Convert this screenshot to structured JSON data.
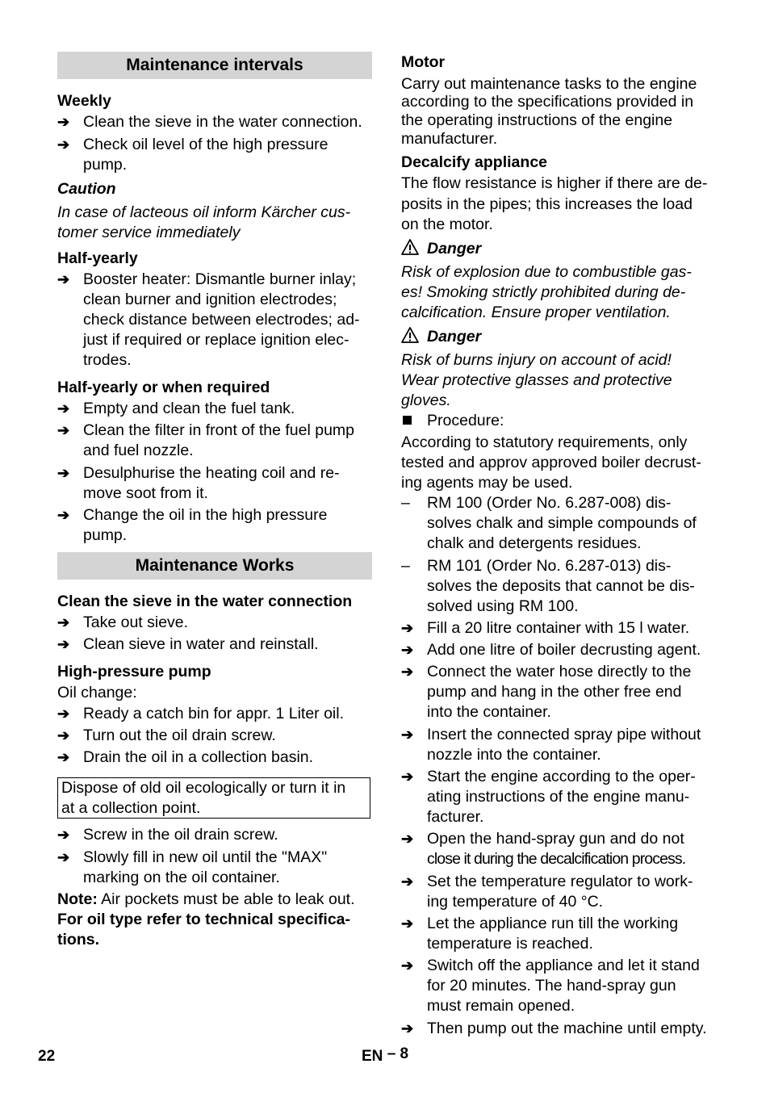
{
  "left": {
    "maintenance_intervals": {
      "title": "Maintenance intervals",
      "weekly": {
        "heading": "Weekly",
        "items": [
          [
            "Clean the sieve in the water connection."
          ],
          [
            "Check oil level of the high pressure",
            "pump."
          ]
        ]
      },
      "caution": {
        "heading": "Caution",
        "lines": [
          "In case of lacteous oil inform Kärcher cus-",
          "tomer service immediately"
        ]
      },
      "half_yearly": {
        "heading": "Half-yearly",
        "items": [
          [
            "Booster heater: Dismantle burner inlay;",
            "clean burner and ignition electrodes;",
            "check distance between electrodes; ad-",
            "just if required or replace ignition elec-",
            "trodes."
          ]
        ]
      },
      "half_yearly_or_required": {
        "heading": "Half-yearly or when required",
        "items": [
          [
            "Empty and clean the fuel tank."
          ],
          [
            "Clean the filter in front of the fuel pump",
            "and fuel nozzle."
          ],
          [
            "Desulphurise the heating coil and re-",
            "move soot from it."
          ],
          [
            "Change the oil in the high pressure",
            "pump."
          ]
        ]
      }
    },
    "maintenance_works": {
      "title": "Maintenance Works",
      "sieve": {
        "heading": "Clean the sieve in the water connection",
        "items": [
          [
            "Take out sieve."
          ],
          [
            "Clean sieve in water and reinstall."
          ]
        ]
      },
      "pump": {
        "heading": "High-pressure pump",
        "intro": "Oil change:",
        "items": [
          [
            "Ready a catch bin for appr. 1 Liter oil."
          ],
          [
            "Turn out the oil drain screw."
          ],
          [
            "Drain the oil in a collection basin."
          ]
        ],
        "notice_box": [
          "Dispose of old oil ecologically or turn it in",
          "at a collection point."
        ],
        "items2": [
          [
            "Screw in the oil drain screw."
          ],
          [
            "Slowly fill in new oil until the \"MAX\"",
            "marking on the oil container."
          ]
        ],
        "note_label": "Note:",
        "note_text": " Air pockets must be able to leak out.",
        "oil_type": [
          "For oil type refer to technical specifica-",
          "tions."
        ]
      }
    }
  },
  "right": {
    "motor": {
      "heading": "Motor",
      "lines": [
        "Carry out maintenance tasks to the engine",
        "according to the specifications provided in",
        "the operating instructions of the engine",
        "manufacturer."
      ]
    },
    "decalcify": {
      "heading": "Decalcify appliance",
      "lines": [
        "The flow resistance is higher if there are de-",
        "posits in the pipes; this increases the load",
        "on the motor."
      ]
    },
    "danger1": {
      "label": "Danger",
      "lines": [
        "Risk of explosion due to combustible gas-",
        "es! Smoking strictly prohibited during de-",
        "calcification. Ensure proper ventilation."
      ]
    },
    "danger2": {
      "label": "Danger",
      "lines": [
        "Risk of burns injury on account of acid!",
        "Wear protective glasses and protective",
        "gloves."
      ]
    },
    "procedure": {
      "label": "Procedure:",
      "lines": [
        "According to statutory requirements, only",
        "tested and approv approved boiler decrust-",
        "ing agents may be used."
      ],
      "dash_items": [
        [
          "RM 100 (Order No. 6.287-008) dis-",
          "solves chalk and simple compounds of",
          "chalk and detergents residues."
        ],
        [
          "RM 101 (Order No. 6.287-013) dis-",
          "solves the deposits that cannot be dis-",
          "solved using RM 100."
        ]
      ],
      "steps": [
        [
          "Fill a 20 litre container with 15 l water."
        ],
        [
          "Add one litre of boiler decrusting agent."
        ],
        [
          "Connect the water hose directly to the",
          "pump and hang in the other free end",
          "into the container."
        ],
        [
          "Insert the connected spray pipe without",
          "nozzle into the container."
        ],
        [
          "Start the engine according to the oper-",
          "ating instructions of the engine manu-",
          "facturer."
        ],
        [
          "Open the hand-spray gun and do not",
          "close it during the decalcification process."
        ],
        [
          "Set the temperature regulator to work-",
          "ing temperature of 40 °C."
        ],
        [
          "Let the appliance run till the working",
          "temperature is reached."
        ],
        [
          "Switch off the appliance and let it stand",
          "for 20 minutes. The hand-spray gun",
          "must remain opened."
        ],
        [
          "Then pump out the machine until empty."
        ]
      ]
    }
  },
  "footer": {
    "page_number": "22",
    "section": "EN",
    "section_page": "– 8"
  },
  "icons": {
    "arrow": "➔",
    "dash": "–",
    "warning": "warning-triangle-icon",
    "square_bullet": "square-bullet-icon"
  }
}
